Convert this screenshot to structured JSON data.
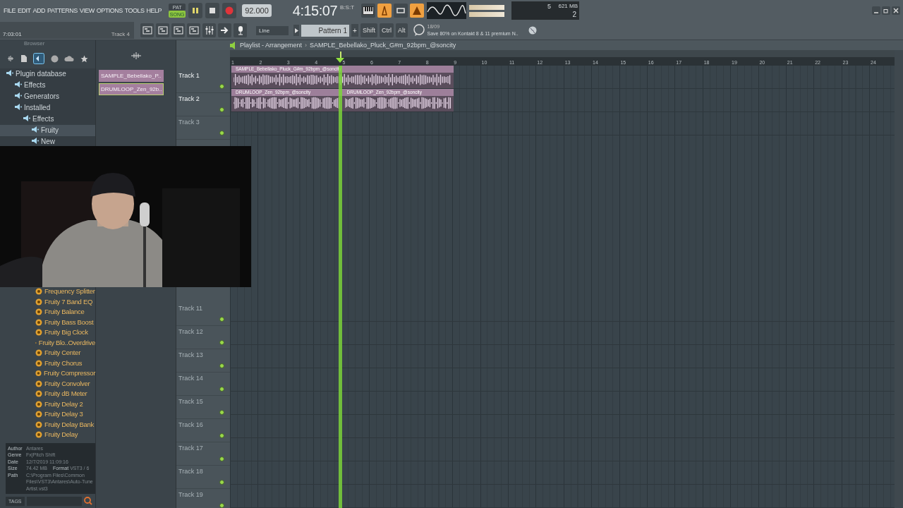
{
  "menu": [
    "FILE",
    "EDIT",
    "ADD",
    "PATTERNS",
    "VIEW",
    "OPTIONS",
    "TOOLS",
    "HELP"
  ],
  "transport": {
    "modes": [
      {
        "label": "PAT",
        "selected": false
      },
      {
        "label": "SONG",
        "selected": true
      }
    ],
    "playing": true,
    "tempo": "92.000",
    "time": "4:15:07",
    "time_format": "B:S:T"
  },
  "cpu": {
    "value": "5",
    "memory": "621 MB",
    "polyphony": "2"
  },
  "hint_bar": {
    "time": "7:03:01",
    "target": "Track 4"
  },
  "snap": "Line",
  "pattern": "Pattern 1",
  "pattern_add": "+",
  "modifier_keys": [
    "Shift",
    "Ctrl",
    "Alt"
  ],
  "news": {
    "date": "18/09",
    "text": "Save 80% on Kontakt 8 & 11 premium N.."
  },
  "browser": {
    "title": "Browser",
    "tree": [
      {
        "label": "Plugin database",
        "selected": false,
        "children": [
          {
            "label": "Effects",
            "selected": false
          },
          {
            "label": "Generators",
            "selected": false
          },
          {
            "label": "Installed",
            "selected": false,
            "children": [
              {
                "label": "Effects",
                "selected": false,
                "children": [
                  {
                    "label": "Fruity",
                    "selected": true
                  },
                  {
                    "label": "New",
                    "selected": false
                  }
                ]
              }
            ]
          }
        ]
      }
    ],
    "plugins": [
      "Frequency Splitter",
      "Fruity 7 Band EQ",
      "Fruity Balance",
      "Fruity Bass Boost",
      "Fruity Big Clock",
      "Fruity Blo..Overdrive",
      "Fruity Center",
      "Fruity Chorus",
      "Fruity Compressor",
      "Fruity Convolver",
      "Fruity dB Meter",
      "Fruity Delay 2",
      "Fruity Delay 3",
      "Fruity Delay Bank",
      "Fruity Delay"
    ],
    "info": [
      {
        "label": "Author",
        "value": "Antares"
      },
      {
        "label": "Genre",
        "value": "Fx|Pitch Shift"
      },
      {
        "label": "Date",
        "value": "12/7/2019 11:09:16"
      },
      {
        "label": "Size",
        "value": "74.42 MB"
      },
      {
        "label": "Path",
        "value": "C:\\Program Files\\Common Files\\VST3\\Antares\\Auto-Tune Artist.vst3"
      }
    ],
    "format": {
      "label": "Format",
      "value": "VST3 / 6"
    },
    "tags_button": "TAGS"
  },
  "picker": [
    {
      "name": "SAMPLE_Bebellako_P..",
      "selected": false
    },
    {
      "name": "DRUMLOOP_Zen_92b..",
      "selected": true
    }
  ],
  "playlist": {
    "title": "Playlist - Arrangement",
    "pattern_name": "SAMPLE_Bebellako_Pluck_G#m_92bpm_@soncity",
    "ruler": [
      "1",
      "2",
      "3",
      "4",
      "5",
      "6",
      "7",
      "8",
      "9",
      "10",
      "11",
      "12",
      "13",
      "14",
      "15",
      "16",
      "17",
      "18",
      "19",
      "20",
      "21",
      "22",
      "23",
      "24"
    ],
    "separator": "›",
    "tracks": [
      {
        "name": "Track 1",
        "empty": false,
        "clips": [
          {
            "name": "SAMPLE_Bebellako_Pluck_G#m_92bpm_@soncity"
          }
        ]
      },
      {
        "name": "Track 2",
        "empty": false,
        "clips": [
          {
            "name": "DRUMLOOP_Zen_92bpm_@soncity"
          },
          {
            "name": "DRUMLOOP_Zen_92bpm_@soncity"
          }
        ]
      },
      {
        "name": "Track 3",
        "empty": true
      },
      {
        "name": "Track 11",
        "empty": true
      },
      {
        "name": "Track 12",
        "empty": true
      },
      {
        "name": "Track 13",
        "empty": true
      },
      {
        "name": "Track 14",
        "empty": true
      },
      {
        "name": "Track 15",
        "empty": true
      },
      {
        "name": "Track 16",
        "empty": true
      },
      {
        "name": "Track 17",
        "empty": true
      },
      {
        "name": "Track 18",
        "empty": true
      },
      {
        "name": "Track 19",
        "empty": true
      }
    ]
  }
}
